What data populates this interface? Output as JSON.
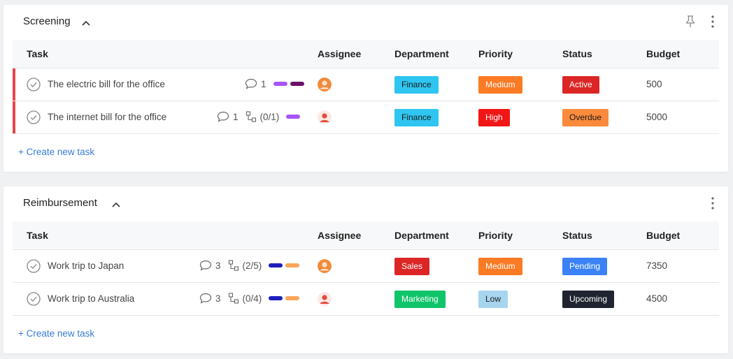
{
  "columns": {
    "task": "Task",
    "assignee": "Assignee",
    "department": "Department",
    "priority": "Priority",
    "status": "Status",
    "budget": "Budget"
  },
  "create_label": "+ Create new task",
  "sections": [
    {
      "title": "Screening",
      "pinned_icon": "pin-icon",
      "rows": [
        {
          "task": "The electric bill for the office",
          "comments": "1",
          "subtasks": "",
          "labels": [
            "#a855f7",
            "#6b0f6b"
          ],
          "assignee_color": "#f08a3c",
          "department": "Finance",
          "department_color": "#2ec5f0",
          "department_text": "#1a1a1a",
          "priority": "Medium",
          "priority_color": "#fb7a24",
          "priority_text": "#ffffff",
          "status": "Active",
          "status_color": "#dc2626",
          "status_text": "#ffffff",
          "budget": "500"
        },
        {
          "task": "The internet bill for the office",
          "comments": "1",
          "subtasks": "(0/1)",
          "labels": [
            "#a855f7"
          ],
          "assignee_color": "#e34a3a",
          "department": "Finance",
          "department_color": "#2ec5f0",
          "department_text": "#1a1a1a",
          "priority": "High",
          "priority_color": "#f01616",
          "priority_text": "#ffffff",
          "status": "Overdue",
          "status_color": "#fb8a3c",
          "status_text": "#1a1a1a",
          "budget": "5000"
        }
      ]
    },
    {
      "title": "Reimbursement",
      "rows": [
        {
          "task": "Work trip to Japan",
          "comments": "3",
          "subtasks": "(2/5)",
          "labels": [
            "#1f1fbf",
            "#fba55a"
          ],
          "assignee_color": "#f08a3c",
          "department": "Sales",
          "department_color": "#dc2626",
          "department_text": "#ffffff",
          "priority": "Medium",
          "priority_color": "#fb7a24",
          "priority_text": "#ffffff",
          "status": "Pending",
          "status_color": "#3b82f6",
          "status_text": "#ffffff",
          "budget": "7350"
        },
        {
          "task": "Work trip to Australia",
          "comments": "3",
          "subtasks": "(0/4)",
          "labels": [
            "#1f1fbf",
            "#fba55a"
          ],
          "assignee_color": "#e34a3a",
          "department": "Marketing",
          "department_color": "#10c46a",
          "department_text": "#ffffff",
          "priority": "Low",
          "priority_color": "#a7d4ef",
          "priority_text": "#1a1a1a",
          "status": "Upcoming",
          "status_color": "#1f2430",
          "status_text": "#ffffff",
          "budget": "4500"
        }
      ]
    }
  ]
}
